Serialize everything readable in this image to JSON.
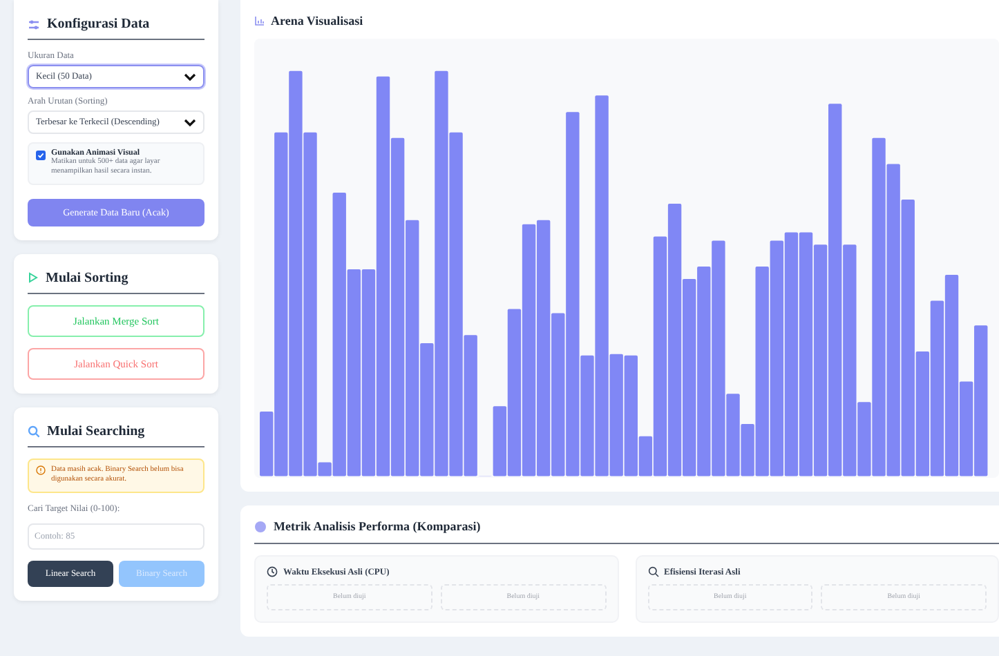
{
  "config": {
    "title": "Konfigurasi Data",
    "size_label": "Ukuran Data",
    "size_value": "Kecil (50 Data)",
    "order_label": "Arah Urutan (Sorting)",
    "order_value": "Terbesar ke Terkecil (Descending)",
    "animation": {
      "label": "Gunakan Animasi Visual",
      "hint": "Matikan untuk 500+ data agar layar menampilkan hasil secara instan.",
      "checked": true
    },
    "generate_button": "Generate Data Baru (Acak)"
  },
  "sorting": {
    "title": "Mulai Sorting",
    "buttons": [
      {
        "label": "Jalankan Merge Sort",
        "kind": "merge"
      },
      {
        "label": "Jalankan Quick Sort",
        "kind": "quick"
      }
    ]
  },
  "searching": {
    "title": "Mulai Searching",
    "warning": "Data masih acak. Binary Search belum bisa digunakan secara akurat.",
    "target_label": "Cari Target Nilai (0-100):",
    "target_placeholder": "Contoh: 85",
    "buttons": [
      {
        "label": "Linear Search",
        "disabled": false
      },
      {
        "label": "Binary Search",
        "disabled": true
      }
    ]
  },
  "arena": {
    "title": "Arena Visualisasi"
  },
  "metrics": {
    "title": "Metrik Analisis Performa (Komparasi)",
    "groups": [
      {
        "title": "Waktu Eksekusi Asli (CPU)",
        "kind": "time",
        "cells": [
          "Belum diuji",
          "Belum diuji"
        ]
      },
      {
        "title": "Efisiensi Iterasi Asli",
        "kind": "search",
        "cells": [
          "Belum diuji",
          "Belum diuji"
        ]
      }
    ]
  }
}
